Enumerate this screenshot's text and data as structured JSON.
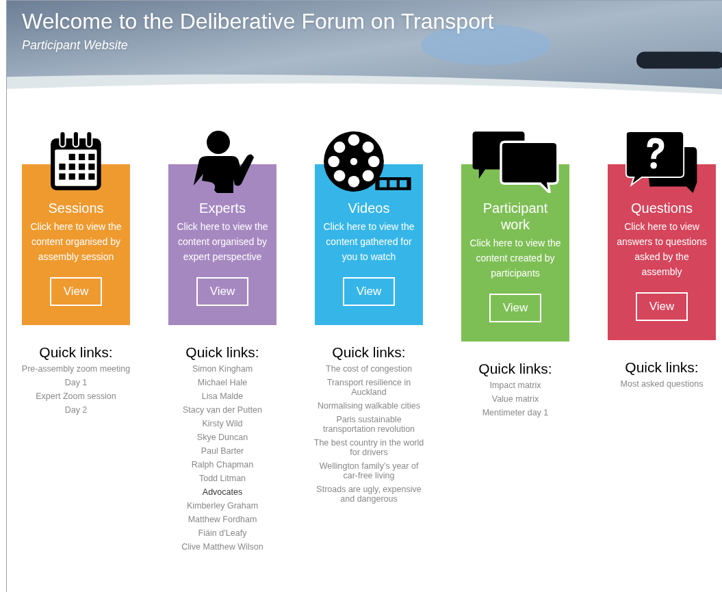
{
  "header": {
    "title": "Welcome to the Deliberative Forum on Transport",
    "subtitle": "Participant Website"
  },
  "sections": [
    {
      "title": "Sessions",
      "color": "#ef9a2f",
      "description": "Click here to view the content organised by assembly session",
      "button": "View",
      "quick_links_heading": "Quick links:",
      "quick_links": [
        {
          "kind": "link",
          "text": "Pre-assembly zoom meeting"
        },
        {
          "kind": "link",
          "text": "Day 1"
        },
        {
          "kind": "link",
          "text": "Expert Zoom session"
        },
        {
          "kind": "link",
          "text": "Day 2"
        }
      ]
    },
    {
      "title": "Experts",
      "color": "#a688c1",
      "description": "Click here to view the content organised by expert perspective",
      "button": "View",
      "quick_links_heading": "Quick links:",
      "quick_links": [
        {
          "kind": "link",
          "text": "Simon Kingham"
        },
        {
          "kind": "link",
          "text": "Michael Hale"
        },
        {
          "kind": "link",
          "text": "Lisa Malde"
        },
        {
          "kind": "link",
          "text": "Stacy van der Putten"
        },
        {
          "kind": "link",
          "text": "Kirsty Wild"
        },
        {
          "kind": "link",
          "text": "Skye Duncan"
        },
        {
          "kind": "link",
          "text": "Paul Barter"
        },
        {
          "kind": "link",
          "text": "Ralph Chapman"
        },
        {
          "kind": "link",
          "text": "Todd Litman"
        },
        {
          "kind": "heading",
          "text": "Advocates"
        },
        {
          "kind": "link",
          "text": "Kimberley Graham"
        },
        {
          "kind": "link",
          "text": "Matthew Fordham"
        },
        {
          "kind": "link",
          "text": "Fiáin d’Leafy"
        },
        {
          "kind": "link",
          "text": "Clive Matthew Wilson"
        }
      ]
    },
    {
      "title": "Videos",
      "color": "#36b6e8",
      "description": "Click here to view the content gathered for you to watch",
      "button": "View",
      "quick_links_heading": "Quick links:",
      "quick_links": [
        {
          "kind": "link",
          "text": "The cost of congestion"
        },
        {
          "kind": "link",
          "text": "Transport resilience in Auckland"
        },
        {
          "kind": "link",
          "text": "Normalising walkable cities"
        },
        {
          "kind": "link",
          "text": "Paris sustainable transportation revolution"
        },
        {
          "kind": "link",
          "text": "The best country in the world for drivers"
        },
        {
          "kind": "link",
          "text": "Wellington family’s year of car-free living"
        },
        {
          "kind": "link",
          "text": "Stroads are ugly, expensive and dangerous"
        }
      ]
    },
    {
      "title": "Participant work",
      "color": "#7ebf55",
      "description": "Click here to view the content created by participants",
      "button": "View",
      "quick_links_heading": "Quick links:",
      "quick_links": [
        {
          "kind": "link",
          "text": "Impact matrix"
        },
        {
          "kind": "link",
          "text": "Value matrix"
        },
        {
          "kind": "link",
          "text": "Mentimeter day 1"
        }
      ]
    },
    {
      "title": "Questions",
      "color": "#d5455b",
      "description": "Click here to view answers to questions asked by the assembly",
      "button": "View",
      "quick_links_heading": "Quick links:",
      "quick_links": [
        {
          "kind": "link",
          "text": "Most asked questions"
        }
      ]
    }
  ]
}
